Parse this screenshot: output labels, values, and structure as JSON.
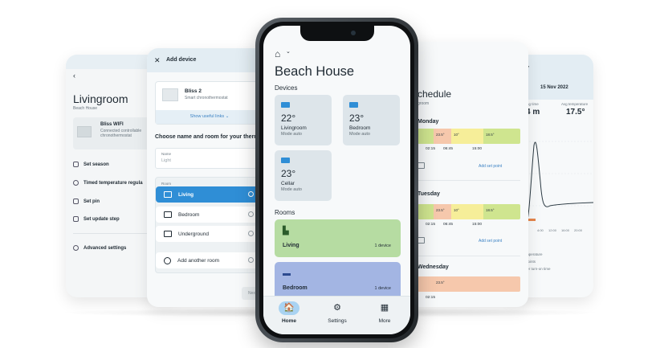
{
  "livingroom_card": {
    "back": "‹",
    "title": "Livingroom",
    "subtitle": "Beach House",
    "device_name": "Bliss WIFI",
    "device_desc": "Connected controllable chronothermostat",
    "menu": [
      "Set season",
      "Timed temperature regula",
      "Set pin",
      "Set update step",
      "Advanced settings"
    ]
  },
  "add_device": {
    "close": "✕",
    "title": "Add device",
    "device_name": "Bliss 2",
    "device_desc": "Smart chronothermostat",
    "useful_links": "Show useful links  ⌄",
    "choose_label": "Choose name and room for your thermos",
    "name_label": "Name",
    "name_value": "Light",
    "room_label": "Room",
    "rooms": [
      "Living",
      "Bedroom",
      "Underground",
      "Add another room"
    ],
    "next": "Next"
  },
  "schedule": {
    "title": "chedule",
    "subtitle": "groom",
    "days": [
      "Monday",
      "Tuesday",
      "Wednesday"
    ],
    "monday_segments": [
      "23.5°",
      "10°",
      "18.5°"
    ],
    "monday_times": [
      "02:15",
      "06:45",
      "15:00"
    ],
    "tuesday_segments": [
      "23.5°",
      "10°",
      "18.5°"
    ],
    "tuesday_times": [
      "02:15",
      "06:45",
      "15:00"
    ],
    "wednesday_segments": [
      "23.5°"
    ],
    "wednesday_times": [
      "02:15"
    ],
    "add_set_point": "Add set point"
  },
  "stats": {
    "header": "y",
    "date": "15 Nov 2022",
    "left_label": "ing time",
    "left_value": "4 m",
    "right_label": "Avg temperature",
    "right_value": "17.5°",
    "axis_ticks": [
      "4:00",
      "12:00",
      "16:00",
      "20:00"
    ],
    "legend": [
      "mperature",
      "points",
      "ter turn-on time"
    ]
  },
  "phone": {
    "home_icon": "⌂",
    "chevron": "⌄",
    "title": "Beach House",
    "devices_heading": "Devices",
    "devices": [
      {
        "temp": "22°",
        "name": "Livingroom",
        "mode": "Mode auto"
      },
      {
        "temp": "23°",
        "name": "Bedroom",
        "mode": "Mode auto"
      },
      {
        "temp": "23°",
        "name": "Cellar",
        "mode": "Mode auto"
      }
    ],
    "rooms_heading": "Rooms",
    "rooms": [
      {
        "name": "Living",
        "count": "1 device"
      },
      {
        "name": "Bedroom",
        "count": "1 device"
      }
    ],
    "tabs": [
      {
        "label": "Home",
        "icon": "house-icon",
        "glyph": "🏠"
      },
      {
        "label": "Settings",
        "icon": "sliders-icon",
        "glyph": "⚙"
      },
      {
        "label": "More",
        "icon": "grid-icon",
        "glyph": "▦"
      }
    ]
  },
  "colors": {
    "accent": "#2f8ed6",
    "room_living": "#b6dca2",
    "room_bedroom": "#a3b5e3",
    "seg_warm": "#f6c8ac",
    "seg_yellow": "#f6ee99",
    "seg_green": "#cfe58f"
  }
}
